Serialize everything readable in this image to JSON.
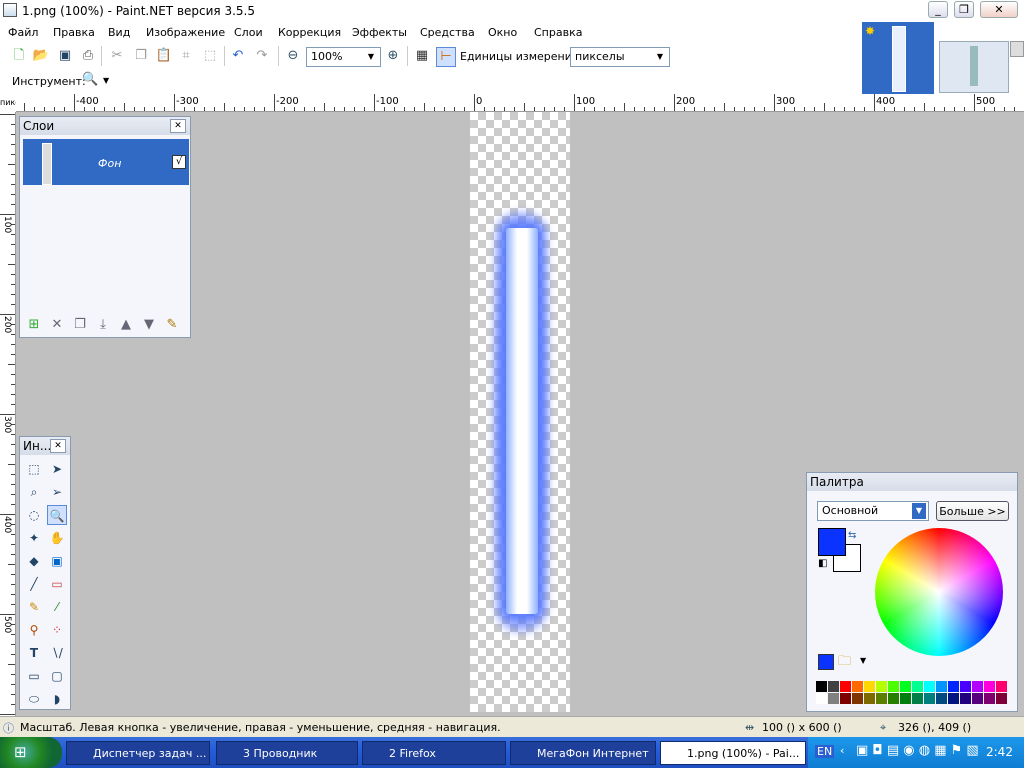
{
  "window": {
    "title": "1.png (100%) - Paint.NET версия 3.5.5"
  },
  "menu": [
    "Файл",
    "Правка",
    "Вид",
    "Изображение",
    "Слои",
    "Коррекция",
    "Эффекты",
    "Средства",
    "Окно",
    "Справка"
  ],
  "toolbar": {
    "zoom_value": "100%",
    "units_label": "Единицы измерения:",
    "units_value": "пикселы",
    "tool_label": "Инструмент:"
  },
  "ruler": {
    "unit": "пиксе",
    "h_labels": [
      "-400",
      "-300",
      "-200",
      "-100",
      "0",
      "100",
      "200",
      "300",
      "400",
      "500"
    ],
    "v_labels": [
      "100",
      "200",
      "300",
      "400",
      "500"
    ]
  },
  "layers_panel": {
    "title": "Слои",
    "layer_name": "Фон",
    "visible_mark": "√"
  },
  "tools_panel": {
    "title": "Ин..."
  },
  "palette_panel": {
    "title": "Палитра",
    "palette_select": "Основной",
    "more_button": "Больше >>",
    "primary_color": "#0b33ff",
    "secondary_color": "#ffffff",
    "swatches_top": [
      "#000000",
      "#404040",
      "#ff0000",
      "#ff6a00",
      "#ffd800",
      "#b6ff00",
      "#4cff00",
      "#00ff21",
      "#00ff90",
      "#00ffff",
      "#0094ff",
      "#0026ff",
      "#4800ff",
      "#b200ff",
      "#ff00dc",
      "#ff006e"
    ],
    "swatches_bottom": [
      "#ffffff",
      "#808080",
      "#7f0000",
      "#7f3300",
      "#7f6a00",
      "#5b7f00",
      "#267f00",
      "#007f0e",
      "#007f46",
      "#007f7f",
      "#004a7f",
      "#00137f",
      "#21007f",
      "#57007f",
      "#7f006e",
      "#7f0037"
    ]
  },
  "status": {
    "hint": "Масштаб. Левая кнопка - увеличение, правая - уменьшение, средняя - навигация.",
    "image_size": "100 () x 600 ()",
    "cursor_pos": "326 (), 409 ()"
  },
  "taskbar": {
    "items": [
      "Диспетчер задач ...",
      "3 Проводник",
      "2 Firefox",
      "МегаФон Интернет",
      "1.png (100%) - Pai..."
    ],
    "lang": "EN",
    "clock": "2:42"
  }
}
